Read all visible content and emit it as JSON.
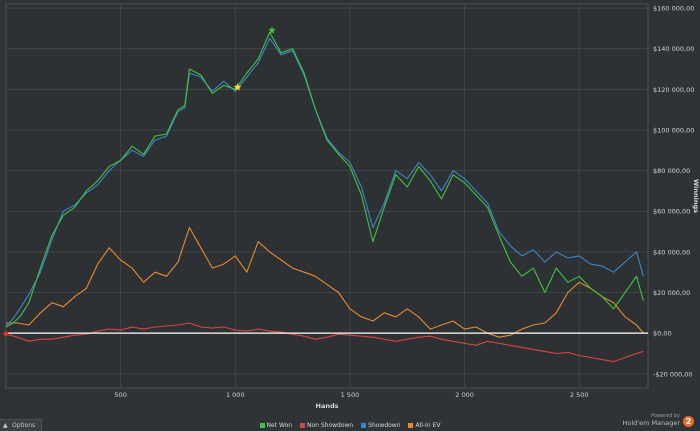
{
  "chart_data": {
    "type": "line",
    "title": "",
    "xlabel": "Hands",
    "ylabel": "Winnings",
    "xlim": [
      0,
      2800
    ],
    "ylim": [
      -27000,
      162000
    ],
    "x_ticks": [
      500,
      1000,
      1500,
      2000,
      2500
    ],
    "x_tick_labels": [
      "500",
      "1 000",
      "1 500",
      "2 000",
      "2 500"
    ],
    "y_ticks": [
      -20000,
      0,
      20000,
      40000,
      60000,
      80000,
      100000,
      120000,
      140000,
      160000
    ],
    "y_tick_labels": [
      "-$20 000,00",
      "$0,00",
      "$20 000,00",
      "$40 000,00",
      "$60 000,00",
      "$80 000,00",
      "$100 000,00",
      "$120 000,00",
      "$140 000,00",
      "$160 000,00"
    ],
    "grid": true,
    "legend_position": "bottom-center",
    "zero_line": true,
    "series": [
      {
        "name": "Net Won",
        "color": "#3ec33e",
        "x": [
          0,
          30,
          60,
          100,
          150,
          200,
          250,
          300,
          350,
          400,
          450,
          500,
          550,
          600,
          650,
          700,
          750,
          780,
          800,
          850,
          900,
          950,
          1000,
          1050,
          1100,
          1150,
          1200,
          1250,
          1300,
          1350,
          1400,
          1450,
          1500,
          1550,
          1600,
          1650,
          1700,
          1750,
          1800,
          1850,
          1900,
          1950,
          2000,
          2050,
          2100,
          2150,
          2200,
          2250,
          2300,
          2350,
          2400,
          2450,
          2500,
          2550,
          2600,
          2650,
          2700,
          2750,
          2780
        ],
        "values": [
          3000,
          5000,
          8000,
          15000,
          32000,
          48000,
          58000,
          62000,
          70000,
          75000,
          82000,
          85000,
          92000,
          88000,
          97000,
          98000,
          110000,
          112000,
          130000,
          127000,
          118000,
          122000,
          120000,
          128000,
          135000,
          148000,
          138000,
          140000,
          128000,
          110000,
          95000,
          88000,
          82000,
          68000,
          45000,
          62000,
          78000,
          72000,
          82000,
          75000,
          66000,
          78000,
          74000,
          68000,
          62000,
          48000,
          35000,
          28000,
          32000,
          20000,
          32000,
          25000,
          28000,
          22000,
          18000,
          12000,
          20000,
          28000,
          16000
        ]
      },
      {
        "name": "Non Showdown",
        "color": "#d64545",
        "x": [
          0,
          50,
          100,
          150,
          200,
          250,
          300,
          350,
          400,
          450,
          500,
          550,
          600,
          650,
          700,
          750,
          800,
          850,
          900,
          950,
          1000,
          1050,
          1100,
          1150,
          1200,
          1250,
          1300,
          1350,
          1400,
          1450,
          1500,
          1550,
          1600,
          1650,
          1700,
          1750,
          1800,
          1850,
          1900,
          1950,
          2000,
          2050,
          2100,
          2150,
          2200,
          2250,
          2300,
          2350,
          2400,
          2450,
          2500,
          2550,
          2600,
          2650,
          2700,
          2750,
          2780
        ],
        "values": [
          -500,
          -2000,
          -4000,
          -3000,
          -3000,
          -2000,
          -1000,
          -500,
          1000,
          2000,
          1500,
          3000,
          2000,
          3000,
          3500,
          4000,
          5000,
          3000,
          2500,
          3000,
          1500,
          1000,
          2000,
          1000,
          500,
          -500,
          -1500,
          -3000,
          -2000,
          -500,
          -1000,
          -1500,
          -2000,
          -3000,
          -4000,
          -3000,
          -2000,
          -1500,
          -3000,
          -4000,
          -5000,
          -6000,
          -4000,
          -5000,
          -6000,
          -7000,
          -8000,
          -9000,
          -10000,
          -9500,
          -11000,
          -12000,
          -13000,
          -14000,
          -12000,
          -10000,
          -9000
        ]
      },
      {
        "name": "Showdown",
        "color": "#3b86c9",
        "x": [
          0,
          30,
          60,
          100,
          150,
          200,
          250,
          300,
          350,
          400,
          450,
          500,
          550,
          600,
          650,
          700,
          750,
          780,
          800,
          850,
          900,
          950,
          1000,
          1050,
          1100,
          1150,
          1200,
          1250,
          1300,
          1350,
          1400,
          1450,
          1500,
          1550,
          1600,
          1650,
          1700,
          1750,
          1800,
          1850,
          1900,
          1950,
          2000,
          2050,
          2100,
          2150,
          2200,
          2250,
          2300,
          2350,
          2400,
          2450,
          2500,
          2550,
          2600,
          2650,
          2700,
          2750,
          2780
        ],
        "values": [
          3500,
          7000,
          12000,
          19000,
          30000,
          46000,
          60000,
          63000,
          69000,
          73000,
          80000,
          85000,
          90000,
          87000,
          95000,
          97000,
          109000,
          111000,
          128000,
          126000,
          119000,
          124000,
          119000,
          126000,
          133000,
          145000,
          137000,
          139000,
          127000,
          110000,
          96000,
          89000,
          84000,
          72000,
          52000,
          64000,
          80000,
          76000,
          84000,
          78000,
          70000,
          80000,
          76000,
          70000,
          64000,
          50000,
          43000,
          38000,
          41000,
          35000,
          40000,
          37000,
          38000,
          34000,
          33000,
          30000,
          35000,
          40000,
          28000
        ]
      },
      {
        "name": "All-In EV",
        "color": "#e68a2e",
        "x": [
          0,
          50,
          100,
          150,
          200,
          250,
          300,
          350,
          400,
          450,
          500,
          550,
          600,
          650,
          700,
          750,
          800,
          850,
          900,
          950,
          1000,
          1050,
          1100,
          1150,
          1200,
          1250,
          1300,
          1350,
          1400,
          1450,
          1500,
          1550,
          1600,
          1650,
          1700,
          1750,
          1800,
          1850,
          1900,
          1950,
          2000,
          2050,
          2100,
          2150,
          2200,
          2250,
          2300,
          2350,
          2400,
          2450,
          2500,
          2550,
          2600,
          2650,
          2700,
          2750,
          2780
        ],
        "values": [
          5000,
          5000,
          4000,
          10000,
          15000,
          13000,
          18000,
          22000,
          34000,
          42000,
          36000,
          32000,
          25000,
          30000,
          28000,
          35000,
          52000,
          42000,
          32000,
          34000,
          38000,
          30000,
          45000,
          40000,
          36000,
          32000,
          30000,
          28000,
          24000,
          20000,
          12000,
          8000,
          6000,
          10000,
          8000,
          12000,
          8000,
          2000,
          4000,
          6000,
          2000,
          3000,
          0,
          -2000,
          -1000,
          2000,
          4000,
          5000,
          10000,
          20000,
          25000,
          22000,
          18000,
          15000,
          8000,
          4000,
          0
        ]
      }
    ],
    "markers": [
      {
        "name": "start",
        "x": 0,
        "y": -300,
        "color": "#e0342b",
        "shape": "diamond"
      },
      {
        "name": "peak",
        "x": 1160,
        "y": 149000,
        "color": "#3ec33e",
        "shape": "star"
      },
      {
        "name": "all-in-peak",
        "x": 1010,
        "y": 121000,
        "color": "#ffe22a",
        "shape": "star"
      }
    ]
  },
  "legend": {
    "items": [
      {
        "label": "Net Won",
        "color": "#3ec33e"
      },
      {
        "label": "Non Showdown",
        "color": "#d64545"
      },
      {
        "label": "Showdown",
        "color": "#3b86c9"
      },
      {
        "label": "All-In EV",
        "color": "#e68a2e"
      }
    ]
  },
  "footer": {
    "options_label": "Options",
    "powered_by": "Powered by",
    "brand_name": "Hold'em Manager",
    "brand_badge": "2"
  }
}
